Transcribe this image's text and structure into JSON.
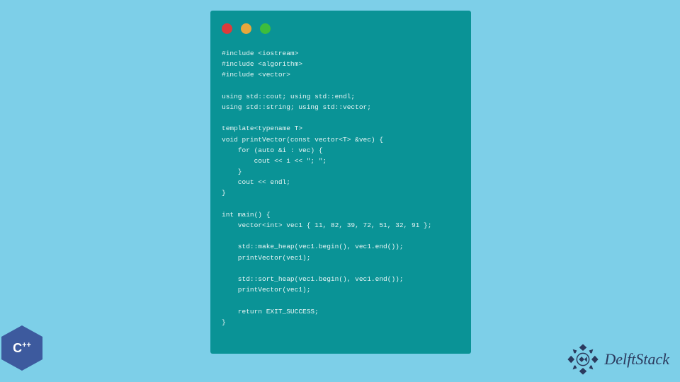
{
  "code": {
    "lines": "#include <iostream>\n#include <algorithm>\n#include <vector>\n\nusing std::cout; using std::endl;\nusing std::string; using std::vector;\n\ntemplate<typename T>\nvoid printVector(const vector<T> &vec) {\n    for (auto &i : vec) {\n        cout << i << \"; \";\n    }\n    cout << endl;\n}\n\nint main() {\n    vector<int> vec1 { 11, 82, 39, 72, 51, 32, 91 };\n\n    std::make_heap(vec1.begin(), vec1.end());\n    printVector(vec1);\n\n    std::sort_heap(vec1.begin(), vec1.end());\n    printVector(vec1);\n\n    return EXIT_SUCCESS;\n}"
  },
  "logos": {
    "cpp_label": "C",
    "cpp_plus": "++",
    "delft_label": "DelftStack"
  },
  "colors": {
    "background": "#7dcfe8",
    "window": "#0a9396",
    "dot_red": "#dd3b3b",
    "dot_yellow": "#e8a73c",
    "dot_green": "#3dbd3d",
    "cpp_hex": "#3d5a9e",
    "delft_text": "#2b3a5e"
  }
}
